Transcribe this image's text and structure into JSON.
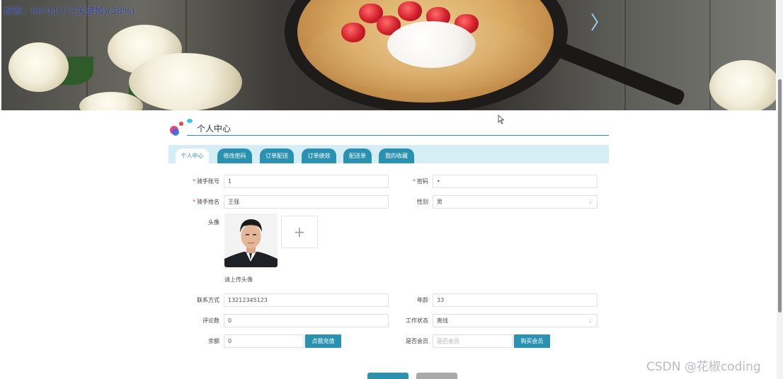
{
  "overlay": {
    "search_text": "搜索：00:04:17(关键帧)(38%)"
  },
  "banner": {
    "next_arrow": "〉"
  },
  "section": {
    "title": "个人中心"
  },
  "tabs": [
    {
      "label": "个人中心",
      "active": true
    },
    {
      "label": "修改密码",
      "active": false
    },
    {
      "label": "订单配送",
      "active": false
    },
    {
      "label": "订单绩效",
      "active": false
    },
    {
      "label": "配送单",
      "active": false
    },
    {
      "label": "我的收藏",
      "active": false
    }
  ],
  "form": {
    "rider_account": {
      "label": "骑手账号",
      "required": true,
      "value": "1"
    },
    "password": {
      "label": "密码",
      "required": true,
      "value": "•"
    },
    "rider_name": {
      "label": "骑手姓名",
      "required": true,
      "value": "王强"
    },
    "gender": {
      "label": "性别",
      "value": "男"
    },
    "avatar": {
      "label": "头像",
      "upload_hint": "请上传头像",
      "upload_icon": "+"
    },
    "contact": {
      "label": "联系方式",
      "value": "13212345123"
    },
    "age": {
      "label": "年龄",
      "value": "33"
    },
    "review_count": {
      "label": "评论数",
      "value": "0"
    },
    "work_status": {
      "label": "工作状态",
      "value": "离线"
    },
    "balance": {
      "label": "余额",
      "value": "0",
      "button": "点我充值"
    },
    "is_member": {
      "label": "是否会员",
      "placeholder": "是否会员",
      "button": "购买会员"
    }
  },
  "footer": {
    "watermark": "CSDN @花椒coding"
  },
  "colors": {
    "accent": "#2a92b1",
    "tab_bar_bg": "#d5eef5",
    "required": "#e15050"
  }
}
